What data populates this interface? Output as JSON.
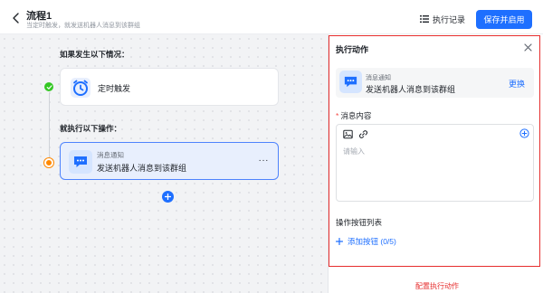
{
  "header": {
    "title": "流程1",
    "subtitle": "当定时触发，就发送机器人消息到该群组",
    "history_label": "执行记录",
    "save_button": "保存并启用"
  },
  "canvas": {
    "condition_label": "如果发生以下情况：",
    "trigger_card": {
      "label": "定时触发",
      "icon": "clock-icon"
    },
    "action_label": "就执行以下操作：",
    "action_card": {
      "category": "消息通知",
      "label": "发送机器人消息到该群组",
      "icon": "message-icon",
      "more": "···"
    }
  },
  "panel": {
    "title": "执行动作",
    "action": {
      "category": "消息通知",
      "label": "发送机器人消息到该群组",
      "change_label": "更换"
    },
    "content_label": "消息内容",
    "required_mark": "*",
    "content_placeholder": "请输入",
    "button_list_label": "操作按钮列表",
    "add_button_label": "添加按钮 (0/5)"
  },
  "caption": "配置执行动作",
  "colors": {
    "accent": "#1e6fff",
    "highlight": "#e62d2d",
    "success": "#34c724",
    "warning": "#ff8800"
  }
}
